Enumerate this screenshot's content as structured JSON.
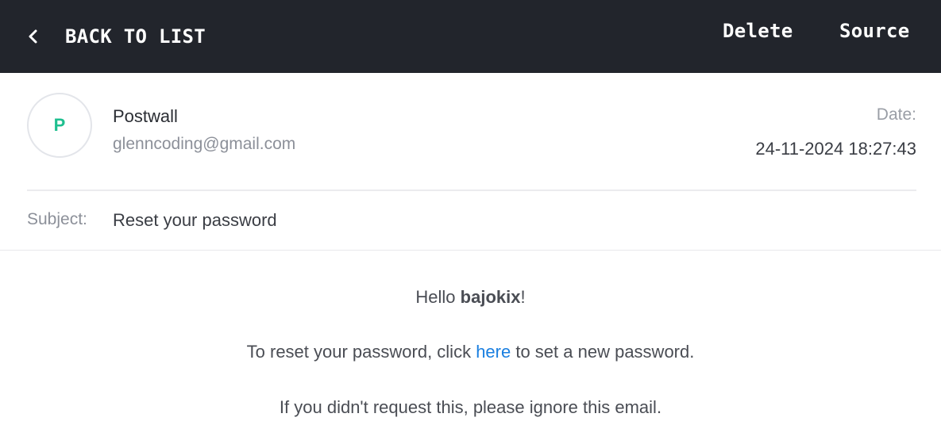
{
  "nav": {
    "back_label": "BACK TO LIST",
    "delete_label": "Delete",
    "source_label": "Source"
  },
  "email": {
    "avatar_initial": "P",
    "sender_name": "Postwall",
    "sender_email": "glenncoding@gmail.com",
    "date_label": "Date:",
    "date_value": "24-11-2024 18:27:43",
    "subject_label": "Subject:",
    "subject_value": "Reset your password"
  },
  "body": {
    "greeting_prefix": "Hello ",
    "greeting_name": "bajokix",
    "greeting_suffix": "!",
    "reset_prefix": "To reset your password, click ",
    "reset_link": "here",
    "reset_suffix": " to set a new password.",
    "ignore_text": "If you didn't request this, please ignore this email."
  },
  "colors": {
    "topbar_bg": "#22252c",
    "avatar_accent": "#1fbf8f",
    "link": "#1a7fe0"
  }
}
